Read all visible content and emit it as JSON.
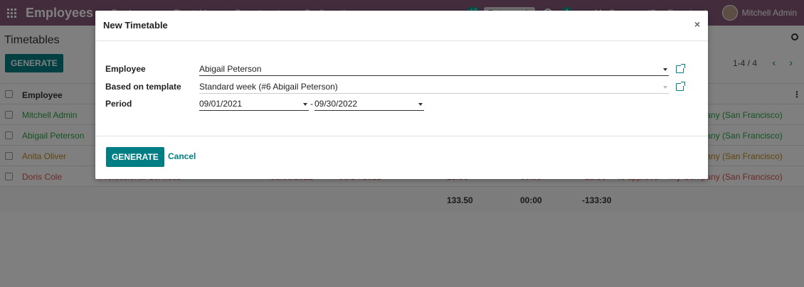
{
  "navbar": {
    "app_title": "Employees",
    "menu": [
      "Employees",
      "Timetables",
      "Departments",
      "Configuration"
    ],
    "messages_count": "17",
    "test_button": "Tests records",
    "activities_count": "4",
    "company": "My Company (San Francisco)",
    "user": "Mitchell Admin",
    "bg_color": "#875a7b"
  },
  "control_panel": {
    "breadcrumb": "Timetables",
    "generate_label": "GENERATE",
    "pager": "1-4 / 4"
  },
  "table": {
    "header_employee": "Employee",
    "rows": [
      {
        "employee": "Mitchell Admin",
        "company": "My Company (San Francisco)"
      },
      {
        "employee": "Abigail Peterson",
        "company": "My Company (San Francisco)"
      },
      {
        "employee": "Anita Oliver",
        "company": "My Company (San Francisco)"
      },
      {
        "employee": "Doris Cole",
        "department": "Professional Services",
        "from": "06/06/2022",
        "to": "06/14/2022",
        "hours": "13.50",
        "extra": "00:00",
        "balance": "-13:30",
        "status": "To approve",
        "company": "My Company (San Francisco)"
      }
    ],
    "totals": {
      "hours": "133.50",
      "extra": "00:00",
      "balance": "-133:30"
    }
  },
  "modal": {
    "title": "New Timetable",
    "close": "×",
    "fields": {
      "employee_label": "Employee",
      "employee_value": "Abigail Peterson",
      "template_label": "Based on template",
      "template_value": "Standard week (#6 Abigail Peterson)",
      "period_label": "Period",
      "period_from": "09/01/2021",
      "period_separator": "-",
      "period_to": "09/30/2022"
    },
    "generate_label": "GENERATE",
    "cancel_label": "Cancel"
  },
  "colors": {
    "primary": "#017e84",
    "brand": "#875a7b"
  }
}
